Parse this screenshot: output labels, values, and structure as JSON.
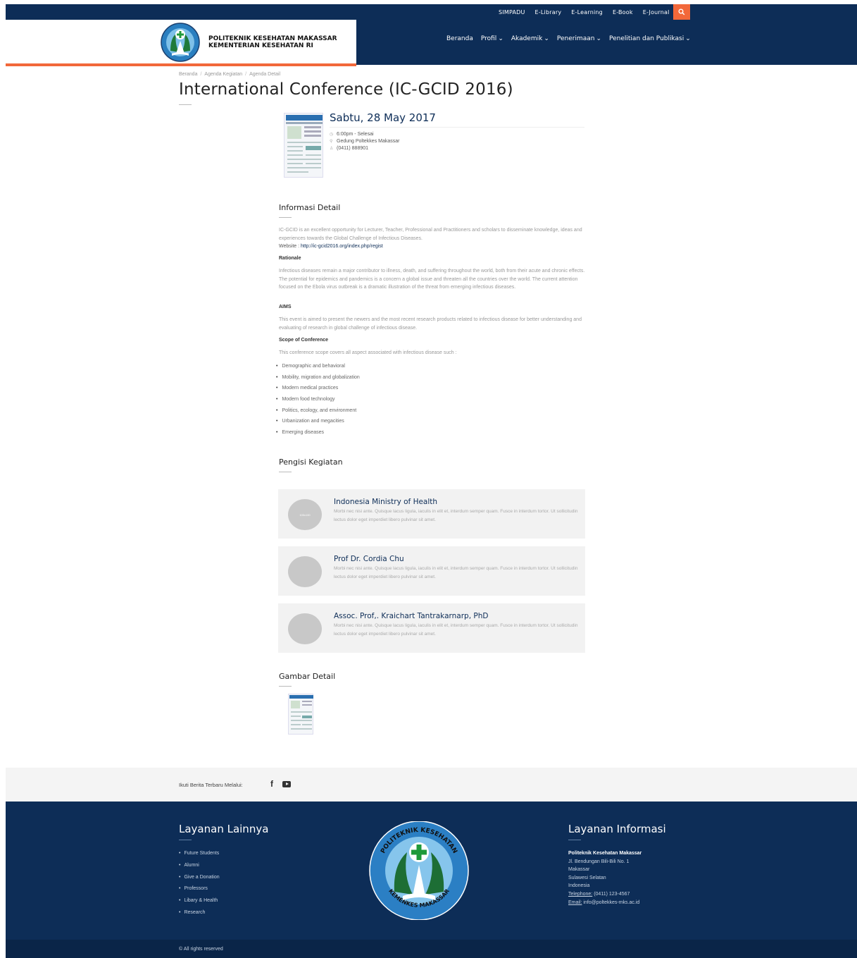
{
  "topbar": {
    "links": [
      "SIMPADU",
      "E-Library",
      "E-Learning",
      "E-Book",
      "E-Journal"
    ]
  },
  "header": {
    "logo_line1": "POLITEKNIK KESEHATAN MAKASSAR",
    "logo_line2": "KEMENTERIAN KESEHATAN RI",
    "nav": [
      "Beranda",
      "Profil",
      "Akademik",
      "Penerimaan",
      "Penelitian dan Publikasi"
    ],
    "caret": "⌄"
  },
  "breadcrumb": [
    "Beranda",
    "Agenda Kegiatan",
    "Agenda Detail"
  ],
  "page_title": "International Conference (IC-GCID 2016)",
  "event": {
    "date": "Sabtu, 28 May 2017",
    "time": "6:00pm - Selesai",
    "place": "Gedung Poltekkes Makassar",
    "phone": "(0411) 888901"
  },
  "informasi": {
    "title": "Informasi Detail",
    "intro": "IC-GCID is an excellent opportunity for Lecturer, Teacher, Professional and Practitioners and scholars to disseminate knowledge, ideas and experiences towards the Global Challenge of Infectious Diseases.",
    "website_label": "Website : ",
    "website_url": "http://ic-gcid2016.org/index.php/regist",
    "rationale_label": "Rationale",
    "rationale": "Infectious diseases remain a major contributor to illness, death, and suffering throughout the world, both from their acute and chronic effects. The potential for epidemics and pandemics is a concern a global issue and threaten all the countries over the world. The current attention focused on the Ebola virus outbreak is a dramatic illustration of the threat from emerging infectious diseases.",
    "aims_label": "AIMS",
    "aims": "This event is aimed to present the newers and the most recent research products related to infectious disease for better understanding and evaluating of research in global challenge of infectious disease.",
    "scope_label": "Scope of Conference",
    "scope_intro": "This conference scope covers all aspect associated with infectious disease such :",
    "scope_items": [
      "Demographic and behavioral",
      "Mobility, migration and globalization",
      "Modern medical practices",
      "Modern food technology",
      "Politics, ecology, and environment",
      "Urbanization and megacities",
      "Emerging diseases"
    ]
  },
  "pengisi": {
    "title": "Pengisi Kegiatan",
    "speakers": [
      {
        "name": "Indonesia Ministry of Health",
        "avatar_text": "100x100",
        "desc": "Morbi nec nisi ante. Quisque lacus ligula, iaculis in elit et, interdum semper quam. Fusce in interdum tortor. Ut sollicitudin lectus dolor eget imperdiet libero pulvinar sit amet."
      },
      {
        "name": "Prof Dr. Cordia Chu",
        "avatar_text": "",
        "desc": "Morbi nec nisi ante. Quisque lacus ligula, iaculis in elit et, interdum semper quam. Fusce in interdum tortor. Ut sollicitudin lectus dolor eget imperdiet libero pulvinar sit amet."
      },
      {
        "name": "Assoc. Prof,. Kraichart Tantrakarnarp, PhD",
        "avatar_text": "",
        "desc": "Morbi nec nisi ante. Quisque lacus ligula, iaculis in elit et, interdum semper quam. Fusce in interdum tortor. Ut sollicitudin lectus dolor eget imperdiet libero pulvinar sit amet."
      }
    ]
  },
  "gambar": {
    "title": "Gambar Detail"
  },
  "social": {
    "label": "Ikuti Berita Terbaru Melalui:",
    "icons": [
      "facebook-icon",
      "youtube-icon"
    ]
  },
  "footer": {
    "left_title": "Layanan Lainnya",
    "links": [
      "Future Students",
      "Alumni",
      "Give a Donation",
      "Professors",
      "Libary & Health",
      "Research"
    ],
    "logo_top": "POLITEKNIK KESEHATAN",
    "logo_bottom": "KEMENKES MAKASSAR",
    "right_title": "Layanan Informasi",
    "org": "Politeknik Kesehatan Makassar",
    "address1": "Jl. Bendungan Bili-Bili No. 1",
    "city": "Makassar",
    "province": "Sulawesi Selatan",
    "country": "Indonesia",
    "phone_label": "Telephone:",
    "phone": " (0411) 123-4567",
    "email_label": "Email:",
    "email": " info@poltekkes-mks.ac.id",
    "copyright": "© All rights reserved"
  },
  "colors": {
    "navy": "#0d2d57",
    "accent": "#f2683a"
  }
}
